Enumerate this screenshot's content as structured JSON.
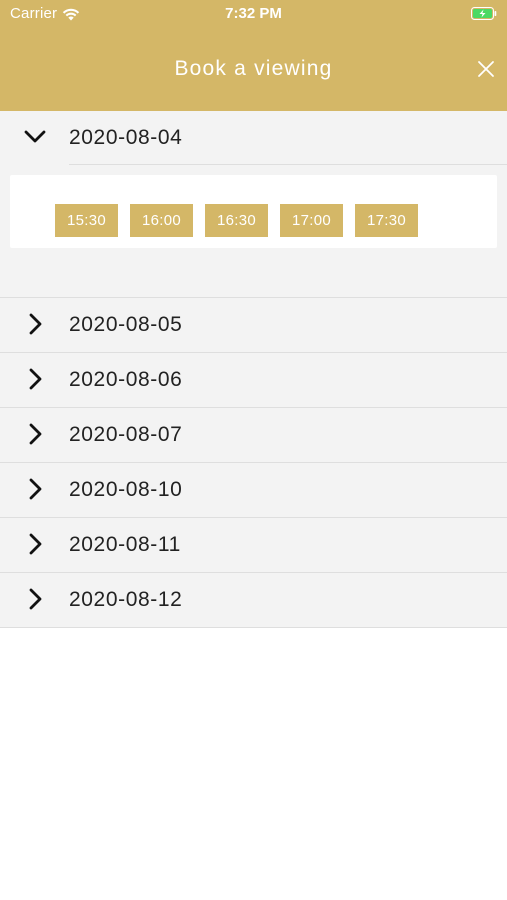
{
  "status_bar": {
    "carrier": "Carrier",
    "time": "7:32 PM"
  },
  "nav": {
    "title": "Book a viewing"
  },
  "colors": {
    "accent": "#d4b767",
    "row_background": "#f3f3f3",
    "divider": "#dedede"
  },
  "expanded": {
    "date": "2020-08-04",
    "slots": [
      "15:30",
      "16:00",
      "16:30",
      "17:00",
      "17:30"
    ]
  },
  "dates": [
    "2020-08-05",
    "2020-08-06",
    "2020-08-07",
    "2020-08-10",
    "2020-08-11",
    "2020-08-12"
  ]
}
